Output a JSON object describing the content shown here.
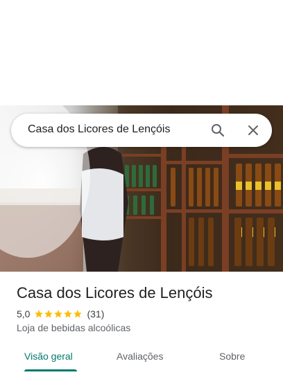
{
  "search": {
    "query": "Casa dos Licores de Lençóis"
  },
  "place": {
    "name": "Casa dos Licores de Lençóis",
    "rating": "5,0",
    "rating_value": 5.0,
    "review_count": "(31)",
    "category": "Loja de bebidas alcoólicas"
  },
  "tabs": [
    {
      "label": "Visão geral",
      "active": true
    },
    {
      "label": "Avaliações",
      "active": false
    },
    {
      "label": "Sobre",
      "active": false
    }
  ],
  "colors": {
    "accent": "#00796b",
    "star": "#fbbc04"
  },
  "icons": {
    "search": "search-icon",
    "close": "close-icon"
  }
}
